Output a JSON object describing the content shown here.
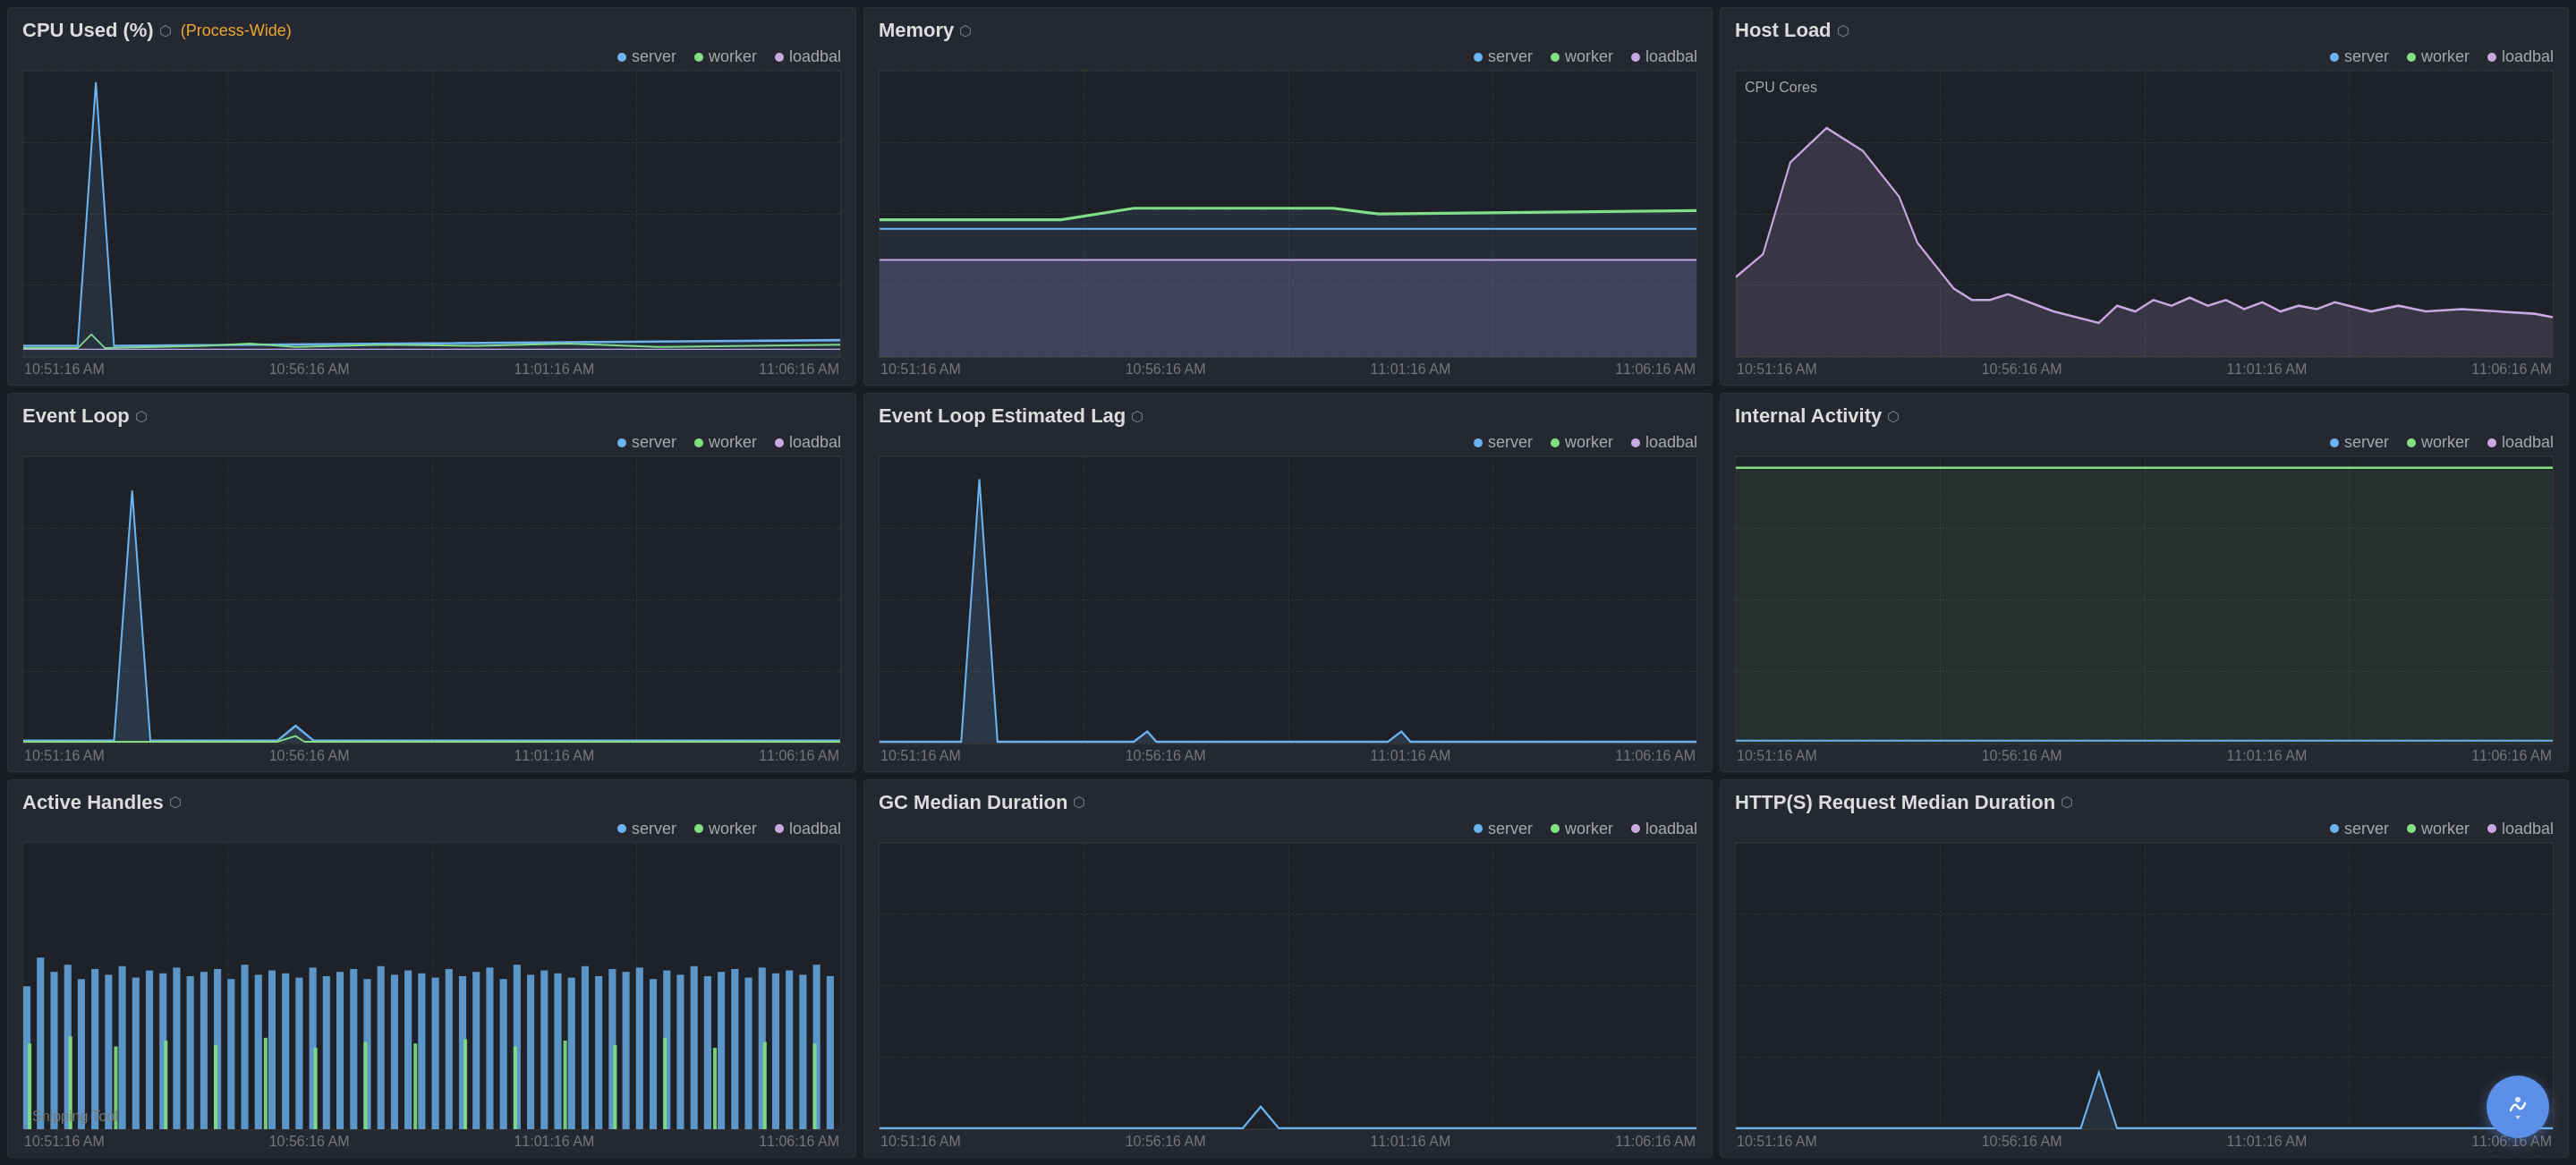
{
  "panels": [
    {
      "id": "cpu-used",
      "title": "CPU Used (%)",
      "subtitle": "(Process-Wide)",
      "has_subtitle": true,
      "chart_type": "cpu",
      "times": [
        "10:51:16 AM",
        "10:56:16 AM",
        "11:01:16 AM",
        "11:06:16 AM"
      ]
    },
    {
      "id": "memory",
      "title": "Memory",
      "subtitle": null,
      "has_subtitle": false,
      "chart_type": "memory",
      "times": [
        "10:51:16 AM",
        "10:56:16 AM",
        "11:01:16 AM",
        "11:06:16 AM"
      ]
    },
    {
      "id": "host-load",
      "title": "Host Load",
      "subtitle": null,
      "has_subtitle": false,
      "chart_type": "host-load",
      "times": [
        "10:51:16 AM",
        "10:56:16 AM",
        "11:01:16 AM",
        "11:06:16 AM"
      ]
    },
    {
      "id": "event-loop",
      "title": "Event Loop",
      "subtitle": null,
      "has_subtitle": false,
      "chart_type": "event-loop",
      "times": [
        "10:51:16 AM",
        "10:56:16 AM",
        "11:01:16 AM",
        "11:06:16 AM"
      ]
    },
    {
      "id": "event-loop-lag",
      "title": "Event Loop Estimated Lag",
      "subtitle": null,
      "has_subtitle": false,
      "chart_type": "event-loop-lag",
      "times": [
        "10:51:16 AM",
        "10:56:16 AM",
        "11:01:16 AM",
        "11:06:16 AM"
      ]
    },
    {
      "id": "internal-activity",
      "title": "Internal Activity",
      "subtitle": null,
      "has_subtitle": false,
      "chart_type": "internal-activity",
      "times": [
        "10:51:16 AM",
        "10:56:16 AM",
        "11:01:16 AM",
        "11:06:16 AM"
      ]
    },
    {
      "id": "active-handles",
      "title": "Active Handles",
      "subtitle": null,
      "has_subtitle": false,
      "chart_type": "active-handles",
      "times": [
        "10:51:16 AM",
        "10:56:16 AM",
        "11:01:16 AM",
        "11:06:16 AM"
      ]
    },
    {
      "id": "gc-median",
      "title": "GC Median Duration",
      "subtitle": null,
      "has_subtitle": false,
      "chart_type": "gc-median",
      "times": [
        "10:51:16 AM",
        "10:56:16 AM",
        "11:01:16 AM",
        "11:06:16 AM"
      ]
    },
    {
      "id": "http-request",
      "title": "HTTP(S) Request Median Duration",
      "subtitle": null,
      "has_subtitle": false,
      "chart_type": "http-request",
      "times": [
        "10:51:16 AM",
        "10:56:16 AM",
        "11:01:16 AM",
        "11:06:16 AM"
      ]
    }
  ],
  "legend": {
    "server": "server",
    "worker": "worker",
    "loadbal": "loadbal"
  },
  "snipping_tooltip": "Snipping Tool",
  "fab_title": "Open Assistant"
}
